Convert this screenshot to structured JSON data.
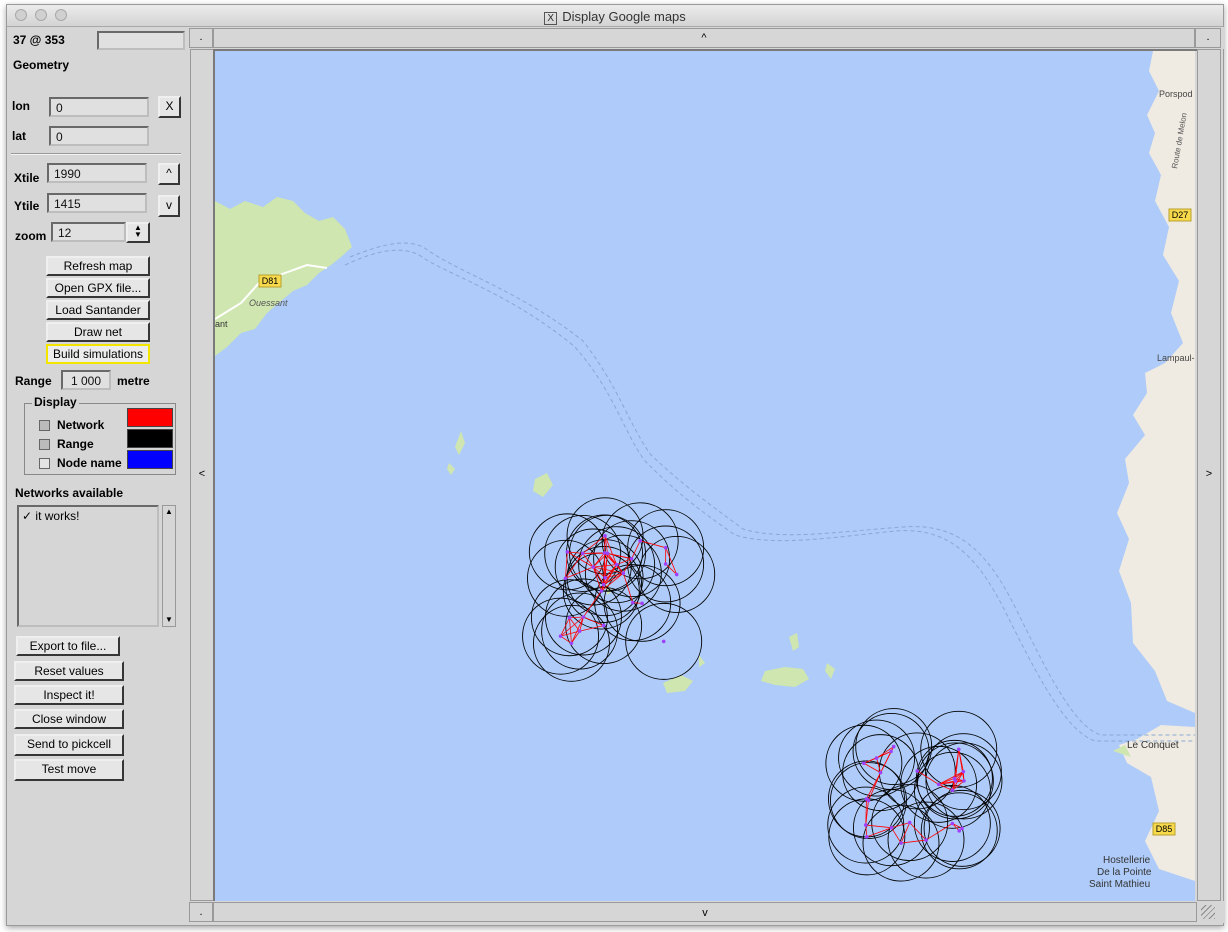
{
  "window": {
    "title": "Display Google maps",
    "x11_glyph": "X"
  },
  "status": {
    "cursor_readout": "37 @ 353",
    "aux_value": ""
  },
  "geometry": {
    "heading": "Geometry",
    "lon_label": "lon",
    "lon_value": "0",
    "clear_label": "X",
    "lat_label": "lat",
    "lat_value": "0",
    "xtile_label": "Xtile",
    "xtile_value": "1990",
    "up_label": "^",
    "ytile_label": "Ytile",
    "ytile_value": "1415",
    "down_label": "v",
    "zoom_label": "zoom",
    "zoom_value": "12"
  },
  "actions": {
    "refresh": "Refresh map",
    "open_gpx": "Open GPX file...",
    "load_santander": "Load Santander",
    "draw_net": "Draw net",
    "build_sim": "Build simulations"
  },
  "range": {
    "label": "Range",
    "value": "1 000",
    "unit": "metre"
  },
  "display": {
    "legend": "Display",
    "items": [
      {
        "label": "Network",
        "checked": true,
        "color": "#ff0000"
      },
      {
        "label": "Range",
        "checked": true,
        "color": "#000000"
      },
      {
        "label": "Node name",
        "checked": false,
        "color": "#0000ff"
      }
    ]
  },
  "networks": {
    "heading": "Networks available",
    "items": [
      {
        "check": "✓",
        "label": "it works!"
      }
    ]
  },
  "bottom_buttons": {
    "export": "Export to file...",
    "reset": "Reset values",
    "inspect": "Inspect it!",
    "close": "Close window",
    "pickcell": "Send to pickcell",
    "test_move": "Test move"
  },
  "scroll": {
    "up": "^",
    "down": "v",
    "left": "<",
    "right": ">",
    "corner_tl": ".",
    "corner_tr": ".",
    "corner_bl": "."
  },
  "map": {
    "labels": {
      "d81": "D81",
      "ouessant": "Ouessant",
      "ant": "ant",
      "porspod": "Porspod",
      "route_melon": "Route de Melon",
      "d27": "D27",
      "lampaul": "Lampaul-",
      "le_conquet": "Le Conquet",
      "d85": "D85",
      "hostellerie1": "Hostellerie",
      "hostellerie2": "De la Pointe",
      "hostellerie3": "Saint Mathieu"
    },
    "colors": {
      "water": "#aecbf9",
      "land": "#efebe2",
      "island": "#cfe6b0",
      "road_badge": "#f7d94c"
    }
  }
}
